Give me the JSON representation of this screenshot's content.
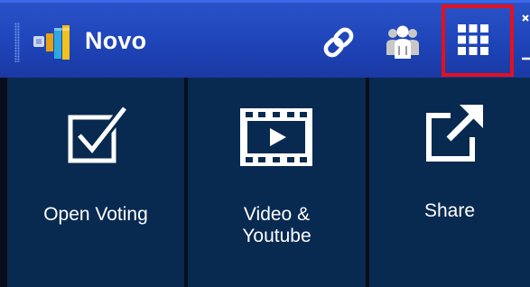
{
  "header": {
    "app_title": "Novo",
    "icons": {
      "logo": "novo-logo-icon",
      "link": "link-icon",
      "people": "people-icon",
      "apps": "apps-grid-icon"
    },
    "colors": {
      "bar": "#1e44b8",
      "highlight": "#e4101c"
    }
  },
  "tiles": [
    {
      "label": "Open Voting",
      "icon": "checkbox-icon"
    },
    {
      "label": "Video & Youtube",
      "label_line1": "Video &",
      "label_line2": "Youtube",
      "icon": "film-play-icon"
    },
    {
      "label": "Share",
      "icon": "share-icon"
    }
  ],
  "colors": {
    "tile_bg": "#082a50",
    "divider": "#0a0e1a"
  }
}
